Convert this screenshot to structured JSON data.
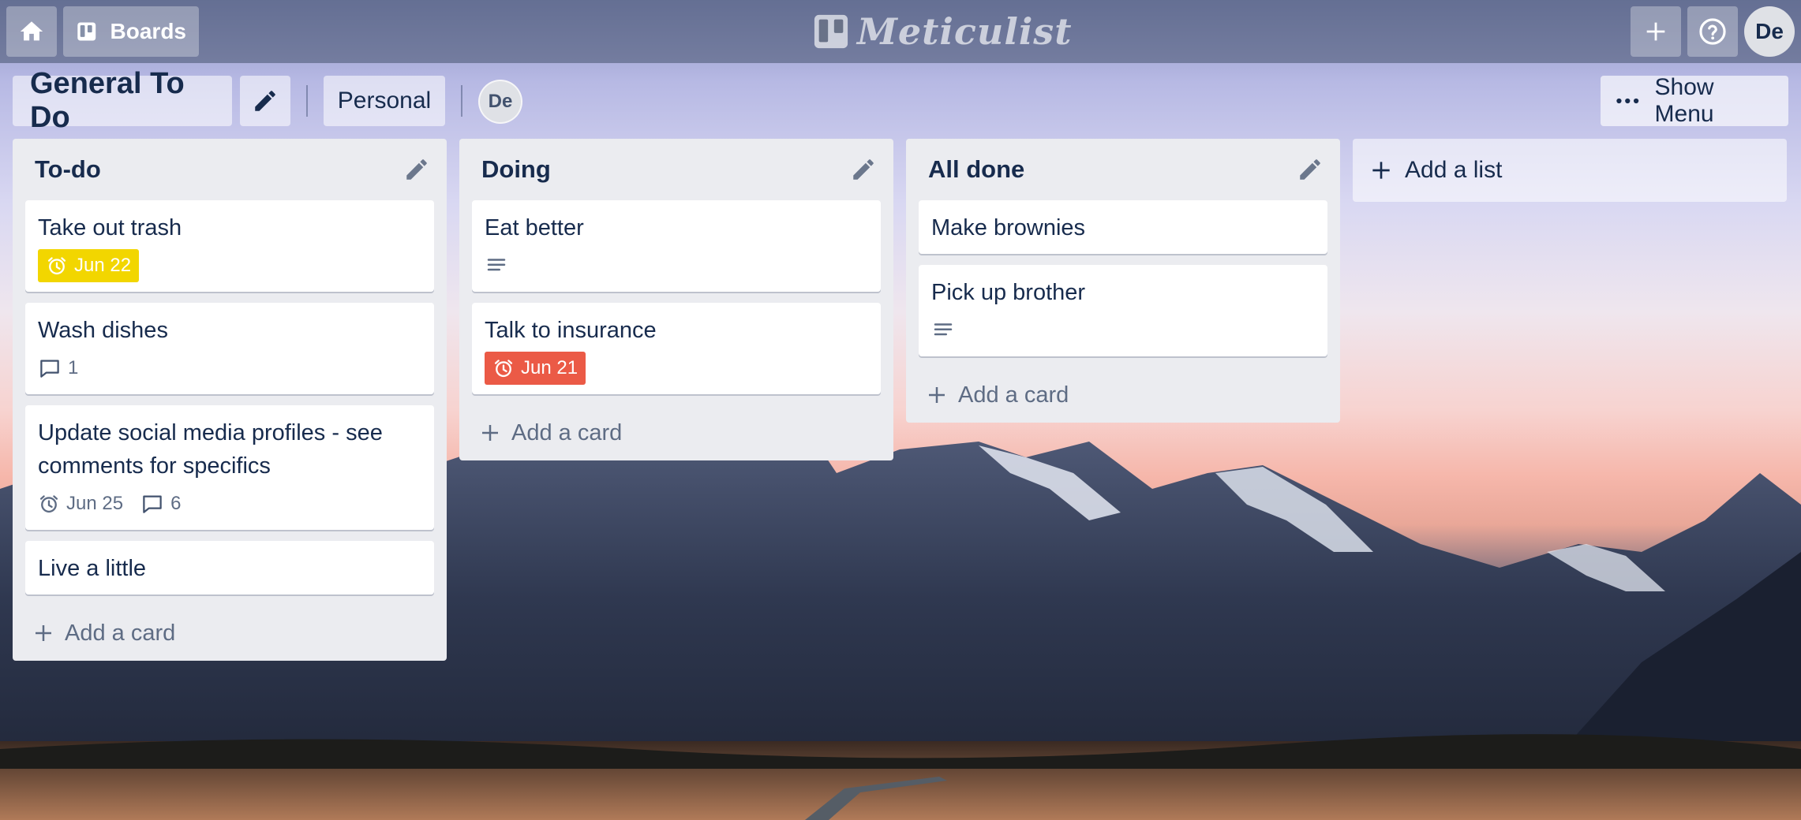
{
  "header": {
    "boards_label": "Boards",
    "logo_text": "Meticulist",
    "user_initials": "De"
  },
  "board": {
    "title": "General To Do",
    "visibility": "Personal",
    "member_initials": "De",
    "menu_label": "Show Menu"
  },
  "lists": [
    {
      "title": "To-do",
      "cards": [
        {
          "title": "Take out trash",
          "due": "Jun 22",
          "due_color": "#f2d600"
        },
        {
          "title": "Wash dishes",
          "comments": "1"
        },
        {
          "title": "Update social media profiles - see comments for specifics",
          "due": "Jun 25",
          "comments": "6"
        },
        {
          "title": "Live a little"
        }
      ],
      "add_card_label": "Add a card"
    },
    {
      "title": "Doing",
      "cards": [
        {
          "title": "Eat better",
          "has_description": true
        },
        {
          "title": "Talk to insurance",
          "due": "Jun 21",
          "due_color": "#eb5a46"
        }
      ],
      "add_card_label": "Add a card"
    },
    {
      "title": "All done",
      "cards": [
        {
          "title": "Make brownies"
        },
        {
          "title": "Pick up brother",
          "has_description": true
        }
      ],
      "add_card_label": "Add a card"
    }
  ],
  "add_list_label": "Add a list",
  "icons": {
    "home": "home-icon",
    "boards": "boards-icon",
    "plus": "plus-icon",
    "help": "help-icon",
    "edit": "pencil-icon",
    "more": "more-dots-icon",
    "due": "clock-icon",
    "comment": "comment-icon",
    "description": "description-icon"
  },
  "colors": {
    "due_soon": "#f2d600",
    "overdue": "#eb5a46",
    "list_bg": "#ebecf0"
  }
}
